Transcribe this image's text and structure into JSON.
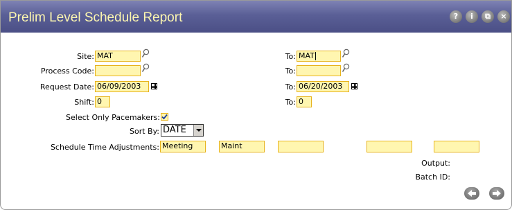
{
  "window": {
    "title": "Prelim Level Schedule Report",
    "buttons": [
      {
        "name": "help-button",
        "glyph": "?"
      },
      {
        "name": "info-button",
        "glyph": "i"
      },
      {
        "name": "restore-button",
        "glyph": "⧉"
      },
      {
        "name": "close-button",
        "glyph": "×"
      }
    ]
  },
  "form": {
    "site": {
      "label": "Site:",
      "from": "MAT",
      "to_label": "To:",
      "to": "MAT"
    },
    "process_code": {
      "label": "Process Code:",
      "from": "",
      "to_label": "To:",
      "to": ""
    },
    "request_date": {
      "label": "Request Date:",
      "from": "06/09/2003",
      "to_label": "To:",
      "to": "06/20/2003"
    },
    "shift": {
      "label": "Shift:",
      "from": "0",
      "to_label": "To:",
      "to": "0"
    },
    "pacemakers": {
      "label": "Select Only Pacemakers:",
      "checked": true
    },
    "sort_by": {
      "label": "Sort By:",
      "value": "DATE"
    },
    "schedule_adjustments": {
      "label": "Schedule Time Adjustments:",
      "values": [
        "Meeting",
        "Maint",
        "",
        "",
        ""
      ]
    },
    "output": {
      "label": "Output:",
      "value": ""
    },
    "batch_id": {
      "label": "Batch ID:",
      "value": ""
    }
  },
  "colors": {
    "titlebar": "#5a5f96",
    "title_text": "#fcf6b0",
    "field_bg": "#fff6b0",
    "field_border": "#e7b31d"
  }
}
